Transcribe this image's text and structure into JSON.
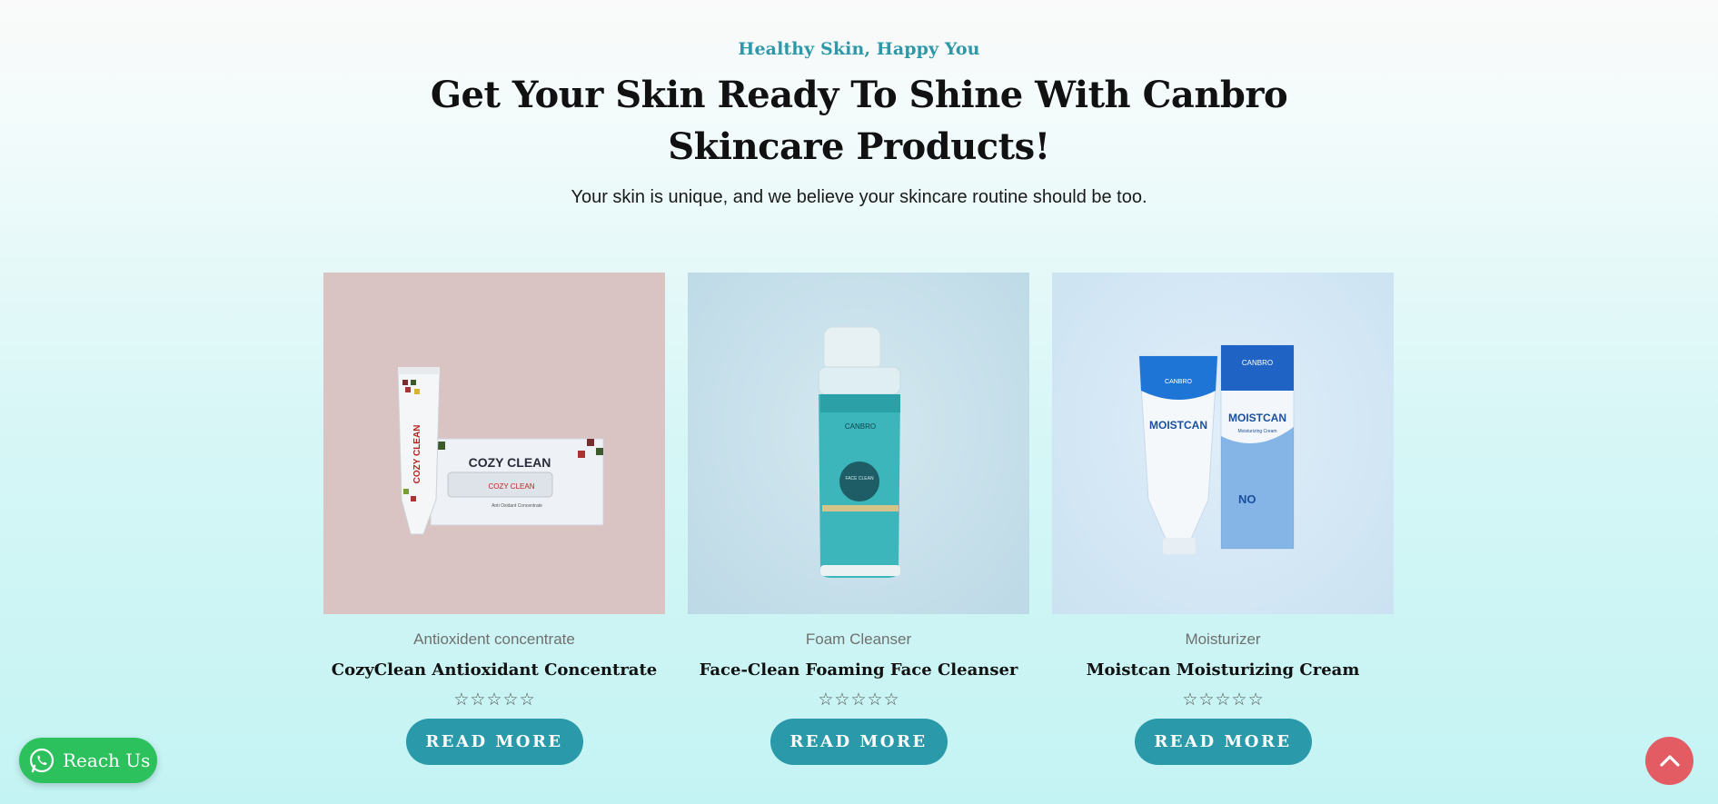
{
  "hero": {
    "eyebrow": "Healthy Skin, Happy You",
    "headline": "Get Your Skin Ready To Shine With Canbro Skincare Products!",
    "subtitle": "Your skin is unique, and we believe your skincare routine should be too."
  },
  "products": [
    {
      "category": "Antioxident concentrate",
      "title": "CozyClean Antioxidant Concentrate",
      "rating": 0,
      "button": "READ MORE",
      "image_text": {
        "tube": "COZY CLEAN",
        "box": "COZY CLEAN",
        "box_sub": "COZY CLEAN",
        "box_caption": "Anti Oxidant Concentrate"
      }
    },
    {
      "category": "Foam Cleanser",
      "title": "Face-Clean Foaming Face Cleanser",
      "rating": 0,
      "button": "READ MORE",
      "image_text": {
        "brand": "CANBRO",
        "label": "FACE CLEAN"
      }
    },
    {
      "category": "Moisturizer",
      "title": "Moistcan Moisturizing Cream",
      "rating": 0,
      "button": "READ MORE",
      "image_text": {
        "brand": "CANBRO",
        "tube": "MOISTCAN",
        "box": "MOISTCAN",
        "sub": "Moisturizing Cream",
        "no": "NO"
      }
    }
  ],
  "whatsapp": {
    "label": "Reach Us",
    "icon": "whatsapp-icon",
    "color": "#2dc15e"
  },
  "scroll_top": {
    "icon": "chevron-up-icon",
    "color": "#e45c63"
  },
  "colors": {
    "accent": "#2a9aab",
    "eyebrow": "#2e98a8"
  }
}
